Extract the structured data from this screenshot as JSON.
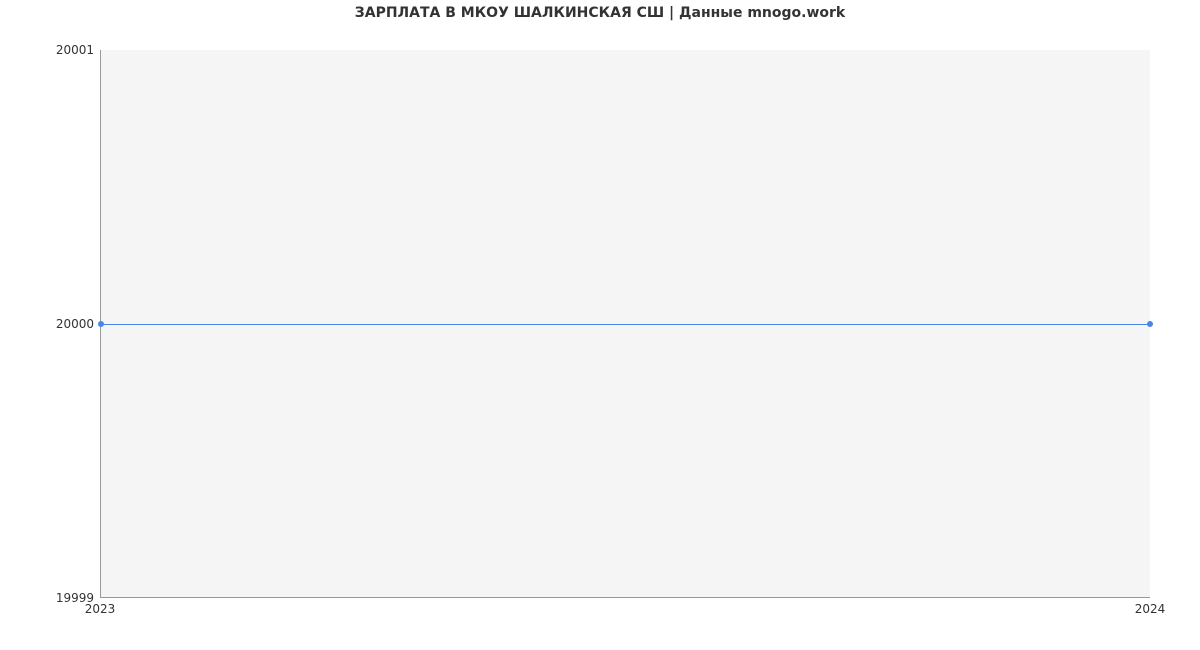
{
  "chart_data": {
    "type": "line",
    "title": "ЗАРПЛАТА В МКОУ ШАЛКИНСКАЯ СШ | Данные mnogo.work",
    "x": [
      2023,
      2024
    ],
    "values": [
      20000,
      20000
    ],
    "xlim": [
      2023,
      2024
    ],
    "ylim": [
      19999,
      20001
    ],
    "x_ticks": [
      "2023",
      "2024"
    ],
    "y_ticks": [
      "19999",
      "20000",
      "20001"
    ],
    "xlabel": "",
    "ylabel": "",
    "line_color": "#4a86e8",
    "plot_bg": "#f5f5f5"
  }
}
